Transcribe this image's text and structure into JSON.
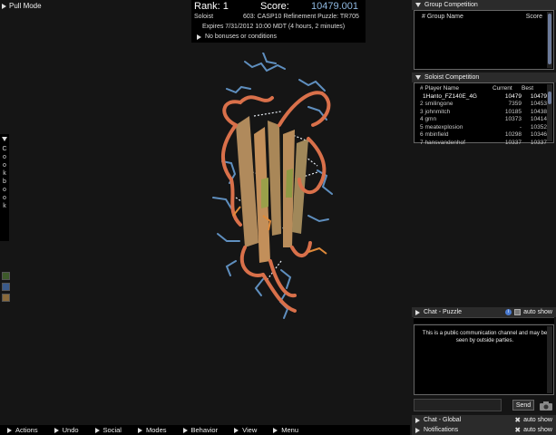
{
  "pull_mode": "Pull Mode",
  "score_panel": {
    "rank": "Rank: 1",
    "score_label": "Score:",
    "score_value": "10479.001",
    "mode": "Soloist",
    "puzzle": "603: CASP10 Refinement Puzzle: TR705",
    "expires": "Expires 7/31/2012 10:00 MDT (4 hours, 2 minutes)",
    "bonus": "No bonuses or conditions"
  },
  "cookbook": {
    "label": "Cookbook"
  },
  "group_competition": {
    "title": "Group Competition",
    "col_name": "# Group Name",
    "col_score": "Score"
  },
  "soloist_competition": {
    "title": "Soloist Competition",
    "columns": [
      "# Player Name",
      "Current",
      "Best"
    ],
    "rows": [
      {
        "rank": "1",
        "name": "Hanto_FZ140E_4G",
        "current": "10479",
        "best": "10479"
      },
      {
        "rank": "2",
        "name": "smilingone",
        "current": "7359",
        "best": "10453"
      },
      {
        "rank": "3",
        "name": "johnmitch",
        "current": "10185",
        "best": "10438"
      },
      {
        "rank": "4",
        "name": "gmn",
        "current": "10373",
        "best": "10414"
      },
      {
        "rank": "5",
        "name": "meatexplosion",
        "current": "-",
        "best": "10352"
      },
      {
        "rank": "6",
        "name": "mbinfield",
        "current": "10298",
        "best": "10346"
      },
      {
        "rank": "7",
        "name": "hansvandenhof",
        "current": "10337",
        "best": "10337"
      }
    ]
  },
  "chat_puzzle": {
    "title": "Chat - Puzzle",
    "auto_show": "auto show",
    "message": "This is a public communication channel and may be seen by outside parties.",
    "send_label": "Send"
  },
  "chat_global": {
    "title": "Chat - Global",
    "auto_show": "auto show"
  },
  "notifications": {
    "title": "Notifications",
    "auto_show": "auto show"
  },
  "bottom_menu": [
    "Actions",
    "Undo",
    "Social",
    "Modes",
    "Behavior",
    "View",
    "Menu"
  ],
  "colors": {
    "background": "#151515",
    "score_value": "#8fb8e0",
    "backbone_orange": "#d9704a",
    "sheet_tan": "#b08a5c",
    "sidechain_blue": "#5f8fbf",
    "hbond_white": "#e8eef5"
  }
}
